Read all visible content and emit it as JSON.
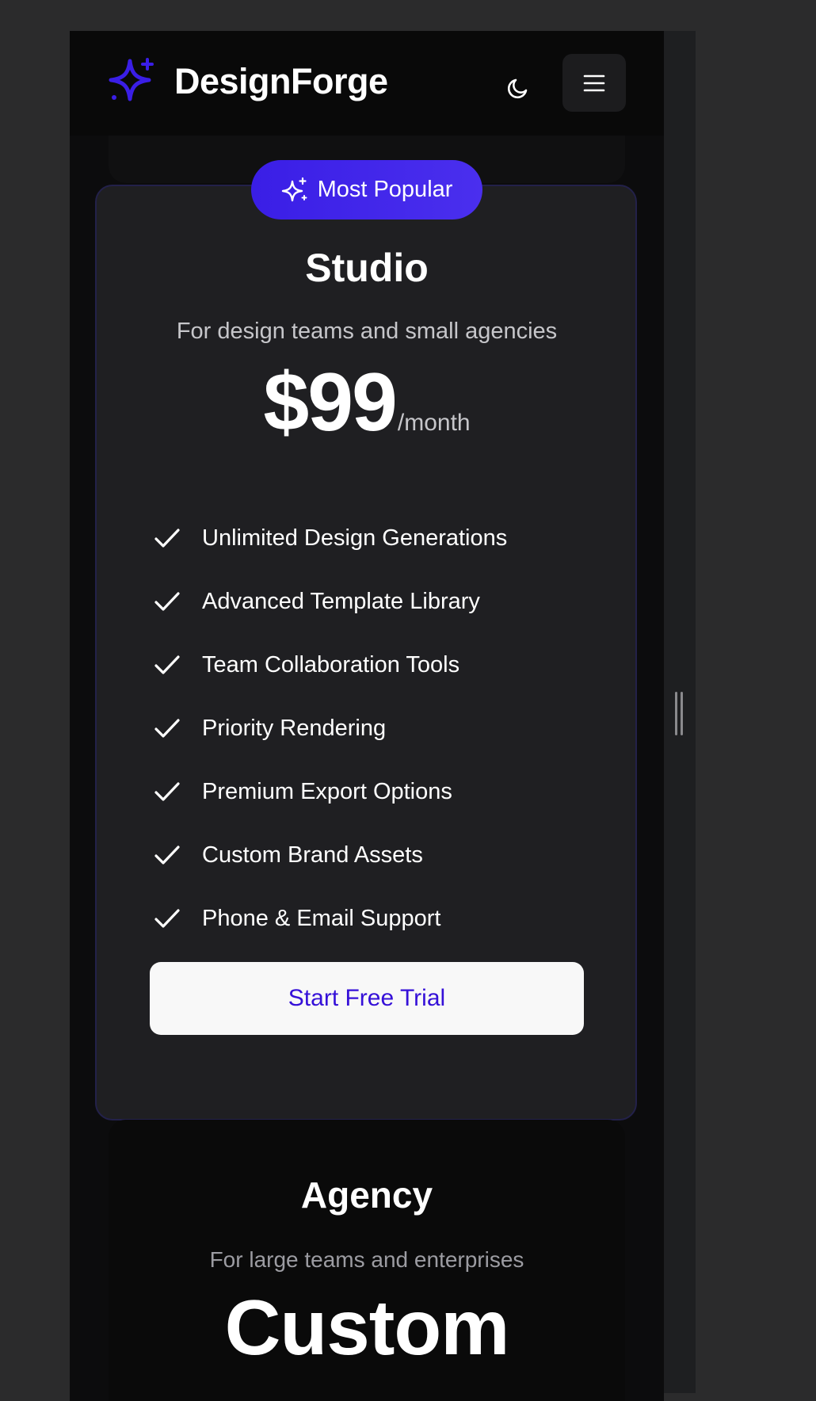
{
  "header": {
    "brand": "DesignForge",
    "theme_toggle_icon": "moon-icon",
    "menu_icon": "hamburger-menu-icon"
  },
  "studio": {
    "badge": "Most Popular",
    "badge_icon": "sparkles-icon",
    "title": "Studio",
    "description": "For design teams and small agencies",
    "price": "$99",
    "period": "/month",
    "features": [
      "Unlimited Design Generations",
      "Advanced Template Library",
      "Team Collaboration Tools",
      "Priority Rendering",
      "Premium Export Options",
      "Custom Brand Assets",
      "Phone & Email Support"
    ],
    "cta": "Start Free Trial"
  },
  "agency": {
    "title": "Agency",
    "description": "For large teams and enterprises",
    "price": "Custom"
  },
  "colors": {
    "accent": "#3a1ee6",
    "background": "#0c0c0d",
    "card": "#1f1f22",
    "cta_text": "#3510d8"
  }
}
